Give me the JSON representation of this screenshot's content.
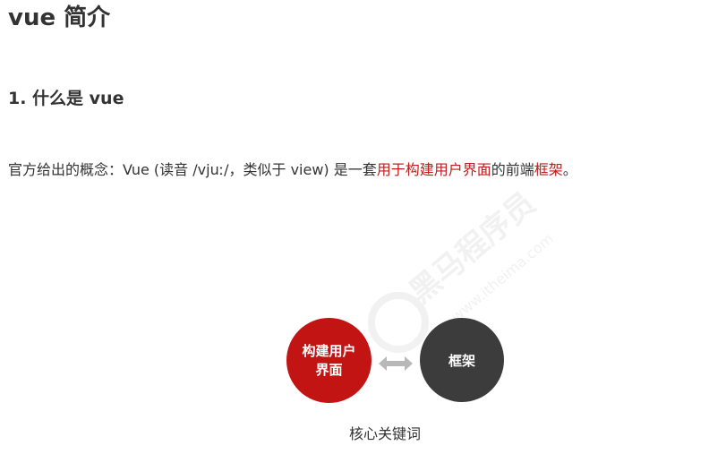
{
  "heading": "vue 简介",
  "section_title": "1. 什么是 vue",
  "paragraph": {
    "part1": "官方给出的概念：Vue (读音 /vjuː/，类似于 view) 是一套",
    "highlight1": "用于构建用户界面",
    "part2": "的前端",
    "highlight2": "框架",
    "part3": "。"
  },
  "diagram": {
    "left_circle_line1": "构建用户",
    "left_circle_line2": "界面",
    "right_circle": "框架",
    "caption": "核心关键词"
  },
  "watermark": {
    "cn_text": "黑马程序员",
    "url_text": "www.itheima.com"
  },
  "colors": {
    "accent_red": "#c21b1b",
    "circle_red": "#c31414",
    "circle_dark": "#3c3c3c",
    "arrow_gray": "#b8b8b8"
  }
}
